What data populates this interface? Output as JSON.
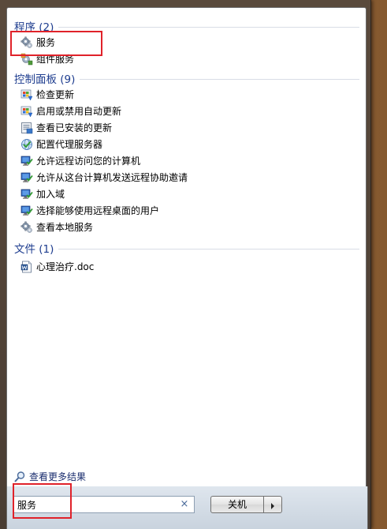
{
  "groups": [
    {
      "title": "程序 (2)",
      "items": [
        {
          "label": "服务",
          "icon": "gear-icon"
        },
        {
          "label": "组件服务",
          "icon": "component-services-icon"
        }
      ]
    },
    {
      "title": "控制面板 (9)",
      "items": [
        {
          "label": "检查更新",
          "icon": "windows-update-icon"
        },
        {
          "label": "启用或禁用自动更新",
          "icon": "windows-update-icon"
        },
        {
          "label": "查看已安装的更新",
          "icon": "installed-updates-icon"
        },
        {
          "label": "配置代理服务器",
          "icon": "internet-options-icon"
        },
        {
          "label": "允许远程访问您的计算机",
          "icon": "remote-computer-icon"
        },
        {
          "label": "允许从这台计算机发送远程协助邀请",
          "icon": "remote-computer-icon"
        },
        {
          "label": "加入域",
          "icon": "remote-computer-icon"
        },
        {
          "label": "选择能够使用远程桌面的用户",
          "icon": "remote-computer-icon"
        },
        {
          "label": "查看本地服务",
          "icon": "gear-icon"
        }
      ]
    },
    {
      "title": "文件 (1)",
      "items": [
        {
          "label": "心理治疗.doc",
          "icon": "word-document-icon"
        }
      ]
    }
  ],
  "see_more": {
    "label": "查看更多结果",
    "icon": "search-icon"
  },
  "search": {
    "value": "服务",
    "clear_icon": "×"
  },
  "shutdown": {
    "label": "关机",
    "arrow_icon": "arrow-right-icon"
  },
  "colors": {
    "highlight": "#e0222a",
    "group_title": "#1e3d8f"
  }
}
